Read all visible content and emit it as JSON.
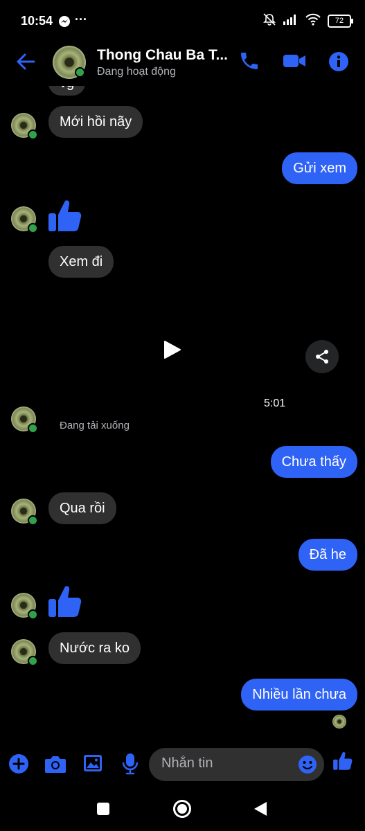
{
  "status_bar": {
    "time": "10:54",
    "battery": "72"
  },
  "header": {
    "name": "Thong Chau Ba T...",
    "presence": "Đang hoạt động"
  },
  "messages": {
    "partial_top": "vg",
    "m1": "Mới hồi nãy",
    "m2": "Gửi xem",
    "m3": "Xem đi",
    "video_duration": "5:01",
    "download_status": "Đang tải xuống",
    "m4": "Chưa thấy",
    "m5": "Qua rồi",
    "m6": "Đã he",
    "m7": "Nước ra ko",
    "m8": "Nhiều lần chưa"
  },
  "composer": {
    "placeholder": "Nhắn tin"
  },
  "colors": {
    "accent": "#2f63f5",
    "incoming_bubble": "#303030",
    "online": "#31a24c"
  }
}
